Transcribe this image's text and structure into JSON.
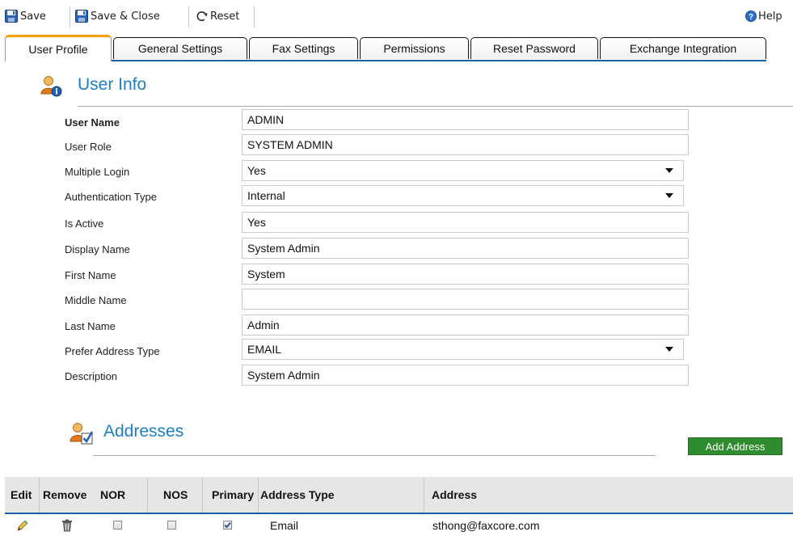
{
  "toolbar": {
    "save_label": "Save",
    "save_close_label": "Save & Close",
    "reset_label": "Reset",
    "help_label": "Help"
  },
  "tabs": [
    {
      "label": "User Profile",
      "active": true
    },
    {
      "label": "General Settings"
    },
    {
      "label": "Fax Settings"
    },
    {
      "label": "Permissions"
    },
    {
      "label": "Reset Password"
    },
    {
      "label": "Exchange Integration"
    }
  ],
  "user_info": {
    "title": "User Info",
    "fields": {
      "user_name": {
        "label": "User Name",
        "value": "ADMIN"
      },
      "user_role": {
        "label": "User Role",
        "value": "SYSTEM ADMIN"
      },
      "multiple_login": {
        "label": "Multiple Login",
        "value": "Yes"
      },
      "auth_type": {
        "label": "Authentication Type",
        "value": "Internal"
      },
      "is_active": {
        "label": "Is Active",
        "value": "Yes"
      },
      "display_name": {
        "label": "Display Name",
        "value": "System Admin"
      },
      "first_name": {
        "label": "First Name",
        "value": "System"
      },
      "middle_name": {
        "label": "Middle Name",
        "value": ""
      },
      "last_name": {
        "label": "Last Name",
        "value": "Admin"
      },
      "prefer_address_type": {
        "label": "Prefer Address Type",
        "value": "EMAIL"
      },
      "description": {
        "label": "Description",
        "value": "System Admin"
      }
    }
  },
  "addresses": {
    "title": "Addresses",
    "add_button": "Add Address",
    "columns": {
      "edit": "Edit",
      "remove": "Remove",
      "nor": "NOR",
      "nos": "NOS",
      "primary": "Primary",
      "address_type": "Address Type",
      "address": "Address"
    },
    "rows": [
      {
        "nor": false,
        "nos": false,
        "primary": true,
        "address_type": "Email",
        "address": "sthong@faxcore.com"
      }
    ]
  },
  "colors": {
    "accent": "#1c7fc5",
    "tab_active": "#f3a10f",
    "add_button": "#2e8b2e",
    "tab_baseline": "#1c5ea8"
  }
}
